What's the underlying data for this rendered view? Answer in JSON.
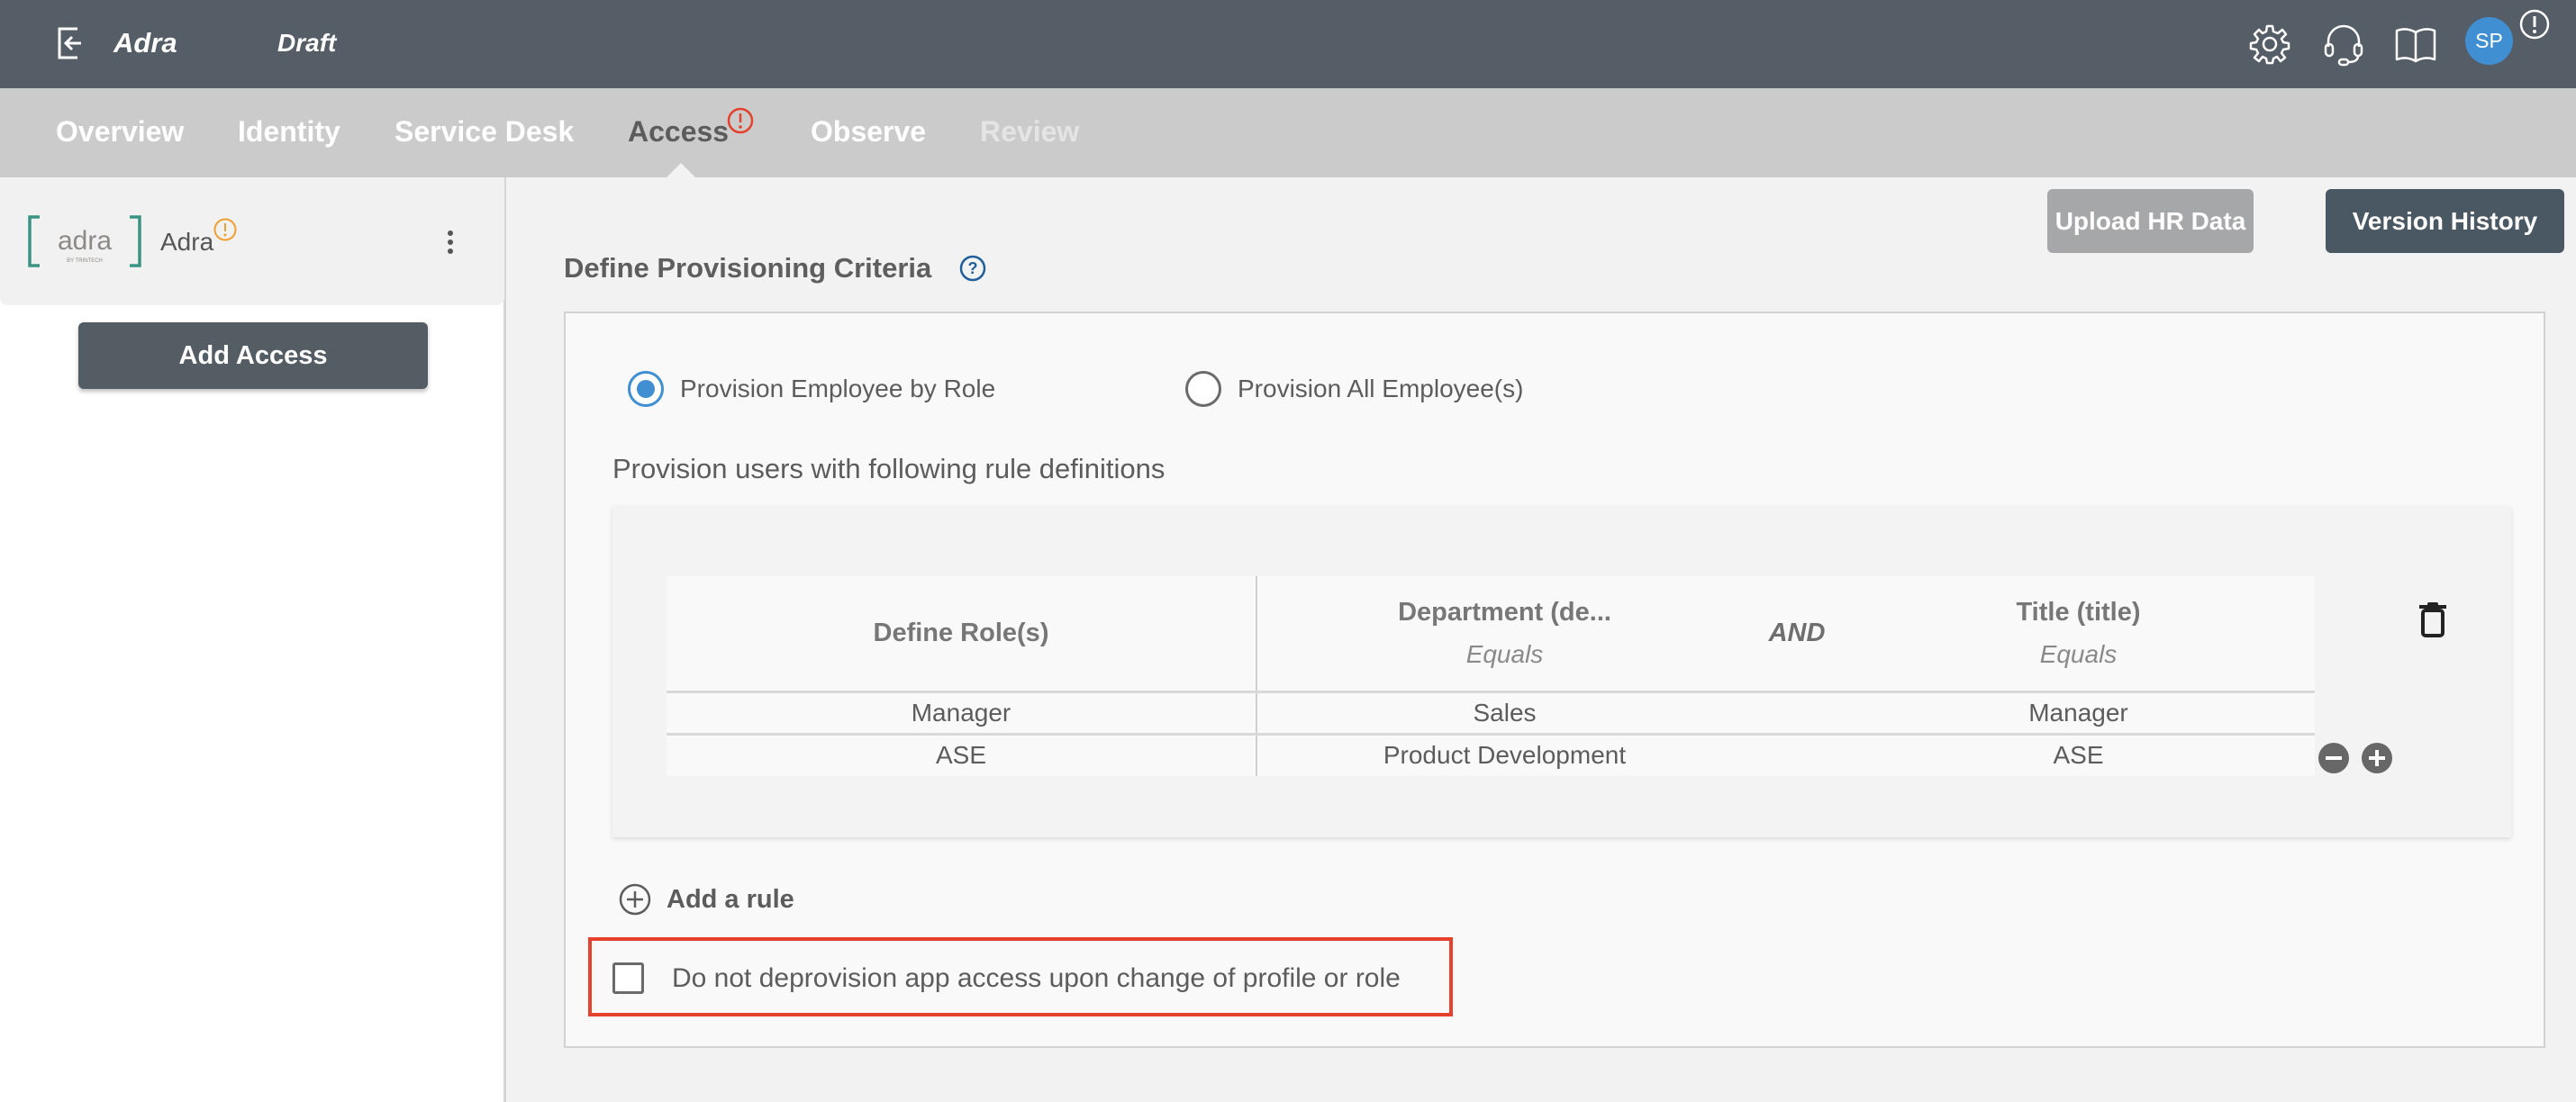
{
  "header": {
    "back_icon": "exit-arrow-icon",
    "app_title": "Adra",
    "status": "Draft",
    "icons": [
      "gear-icon",
      "headset-icon",
      "book-icon"
    ],
    "avatar_initials": "SP",
    "notification_icon": "alert-circle-icon"
  },
  "nav": {
    "tabs": [
      {
        "label": "Overview",
        "state": "normal"
      },
      {
        "label": "Identity",
        "state": "normal"
      },
      {
        "label": "Service Desk",
        "state": "normal"
      },
      {
        "label": "Access",
        "state": "active",
        "has_alert": true
      },
      {
        "label": "Observe",
        "state": "normal"
      },
      {
        "label": "Review",
        "state": "disabled"
      }
    ],
    "upload_button": "Upload HR Data",
    "version_button": "Version History"
  },
  "sidebar": {
    "app_card": {
      "logo_text": "adra",
      "logo_subtext": "BY TRINTECH",
      "name": "Adra",
      "has_warning": true
    },
    "add_access_button": "Add Access"
  },
  "main": {
    "section_title": "Define Provisioning Criteria",
    "radio_options": [
      {
        "label": "Provision Employee by Role",
        "checked": true
      },
      {
        "label": "Provision All Employee(s)",
        "checked": false
      }
    ],
    "rules_caption": "Provision users with following rule definitions",
    "rule_table": {
      "headers": {
        "role": "Define Role(s)",
        "dept": "Department (de...",
        "dept_operator": "Equals",
        "conjunction": "AND",
        "title": "Title (title)",
        "title_operator": "Equals"
      },
      "rows": [
        {
          "role": "Manager",
          "dept": "Sales",
          "title": "Manager"
        },
        {
          "role": "ASE",
          "dept": "Product Development",
          "title": "ASE"
        }
      ]
    },
    "add_rule": "Add a rule",
    "deprovision_checkbox": {
      "label": "Do not deprovision app access upon change of profile or role",
      "checked": false
    }
  },
  "colors": {
    "topbar": "#555d66",
    "navbar": "#cbcbcb",
    "accent_blue": "#3f8fd2",
    "alert_red": "#e5412d",
    "warning_orange": "#f0a030"
  }
}
